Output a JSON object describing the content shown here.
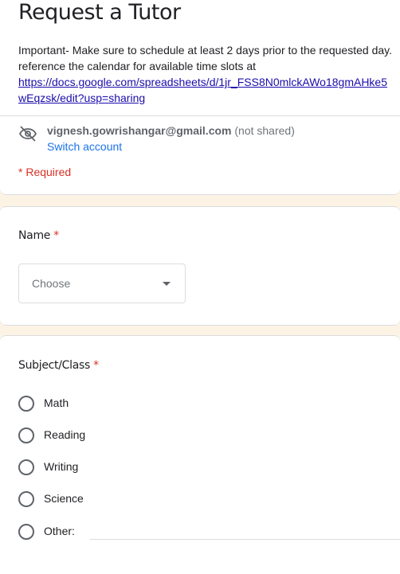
{
  "header": {
    "title": "Request a Tutor",
    "description_line1": "Important- Make sure to schedule at least 2 days prior to the requested day.",
    "description_line2": "reference the calendar for available time slots at",
    "link_line1": "https://docs.google.com/spreadsheets/d/1jr_FSS8N0mlckAWo18gmAHke5",
    "link_line2": "wEqzsk/edit?usp=sharing",
    "account_email": "vignesh.gowrishangar@gmail.com",
    "account_note": "(not shared)",
    "switch_account": "Switch account",
    "required_note": "* Required"
  },
  "questions": {
    "name": {
      "title": "Name",
      "required_mark": "*",
      "dropdown_value": "Choose"
    },
    "subject": {
      "title": "Subject/Class",
      "required_mark": "*",
      "options": [
        "Math",
        "Reading",
        "Writing",
        "Science",
        "Other:"
      ]
    }
  },
  "icons": {
    "account": "eye-off-icon",
    "dropdown": "caret-down-icon"
  },
  "colors": {
    "background": "#fdf3e5",
    "required": "#d93025",
    "link": "#1a0dab",
    "accent": "#1a73e8"
  }
}
